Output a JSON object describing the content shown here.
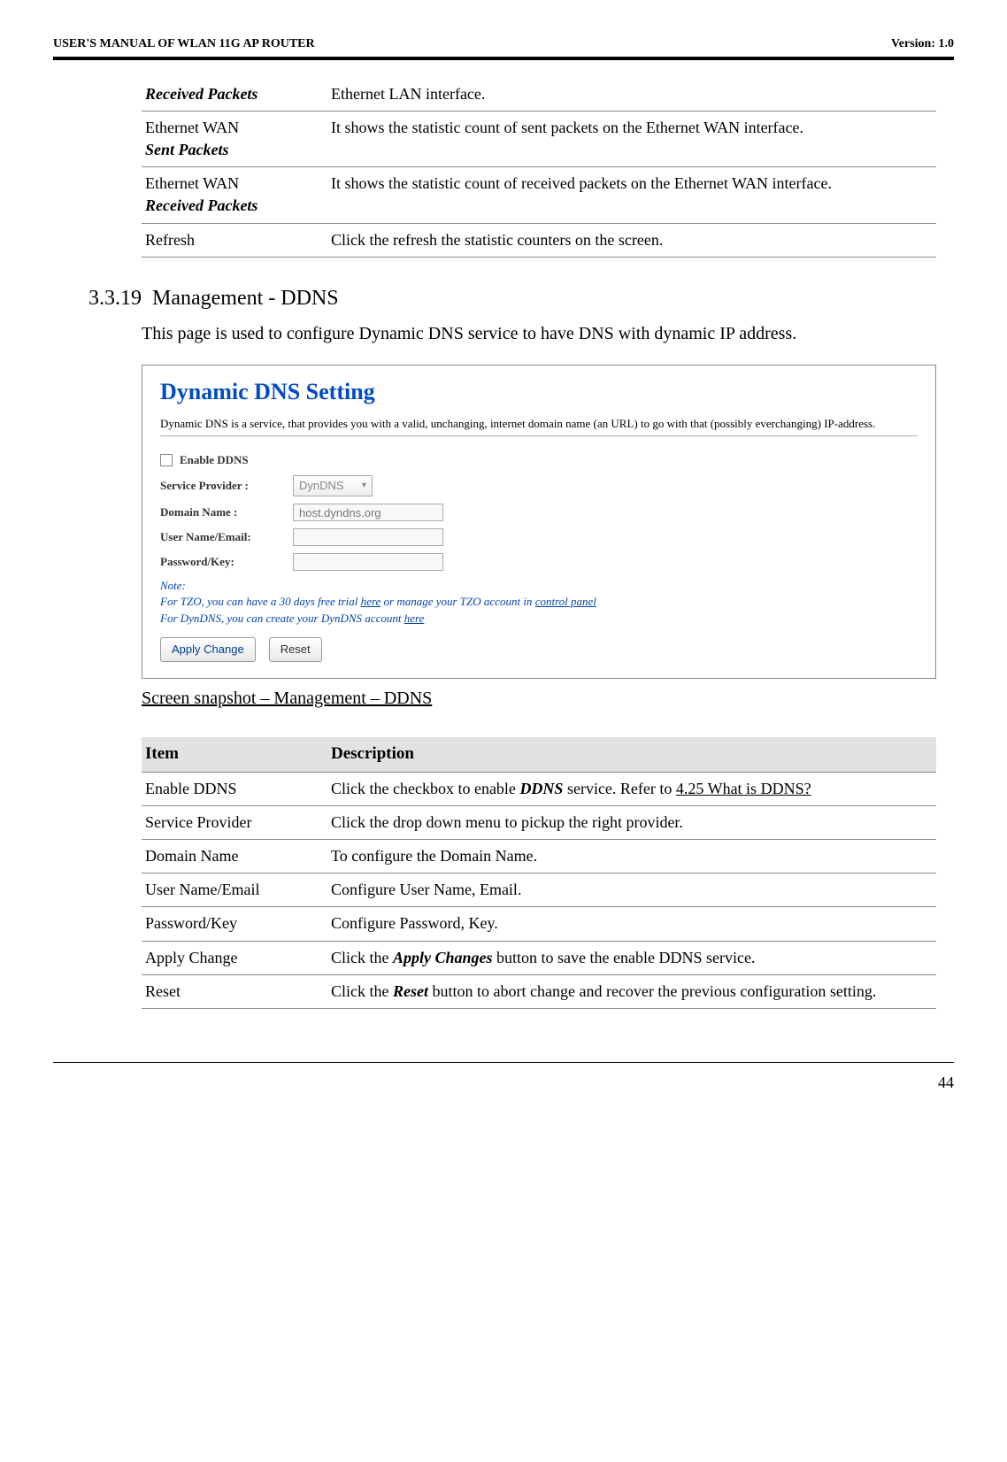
{
  "header": {
    "left": "USER'S MANUAL OF WLAN 11G AP ROUTER",
    "right": "Version: 1.0"
  },
  "top_table": {
    "rows": [
      {
        "c1a": "Received Packets",
        "c2": "Ethernet LAN interface."
      },
      {
        "c1a": "Ethernet WAN",
        "c1b": "Sent Packets",
        "c2": "It shows the statistic count of sent packets on the Ethernet WAN interface."
      },
      {
        "c1a": "Ethernet WAN",
        "c1b": "Received Packets",
        "c2": "It shows the statistic count of received packets on the Ethernet WAN interface."
      },
      {
        "c1a": "Refresh",
        "c2": "Click the refresh the statistic counters on the screen."
      }
    ]
  },
  "section": {
    "num": "3.3.19",
    "title": "Management - DDNS",
    "body": "This page is used to configure Dynamic DNS service to have DNS with dynamic IP address."
  },
  "screenshot": {
    "title": "Dynamic DNS  Setting",
    "desc": "Dynamic DNS is a service, that provides you with a valid, unchanging, internet domain name (an URL) to go with that (possibly everchanging) IP-address.",
    "enable_label": "Enable DDNS",
    "fields": {
      "service_provider_label": "Service Provider :",
      "service_provider_value": "DynDNS",
      "domain_label": "Domain Name :",
      "domain_placeholder": "host.dyndns.org",
      "user_label": "User Name/Email:",
      "pass_label": "Password/Key:"
    },
    "note": {
      "head": "Note:",
      "line1a": "For TZO, you can have a 30 days free trial ",
      "here1": "here",
      "line1b": " or manage your TZO account in ",
      "ctrl": "control panel",
      "line2a": "For DynDNS, you can create your DynDNS account ",
      "here2": "here"
    },
    "buttons": {
      "apply": "Apply Change",
      "reset": "Reset"
    }
  },
  "caption": "Screen snapshot – Management – DDNS",
  "desc_table": {
    "header": {
      "c1": "Item",
      "c2": "Description"
    },
    "rows": [
      {
        "c1": "Enable DDNS",
        "c2a": "Click the checkbox to enable ",
        "c2b": "DDNS",
        "c2c": " service. Refer to ",
        "c2link": "4.25 What is DDNS?"
      },
      {
        "c1": "Service Provider",
        "c2": "Click the drop down menu to pickup the right provider."
      },
      {
        "c1": "Domain Name",
        "c2": "To configure the Domain Name."
      },
      {
        "c1": "User Name/Email",
        "c2": "Configure User Name, Email."
      },
      {
        "c1": "Password/Key",
        "c2": "Configure Password, Key."
      },
      {
        "c1": "Apply Change",
        "c2a": "Click the ",
        "c2b": "Apply Changes",
        "c2c": " button to save the enable DDNS service."
      },
      {
        "c1": "Reset",
        "c2a": "Click the ",
        "c2b": "Reset",
        "c2c": " button to abort change and recover the previous configuration setting."
      }
    ]
  },
  "page_number": "44"
}
